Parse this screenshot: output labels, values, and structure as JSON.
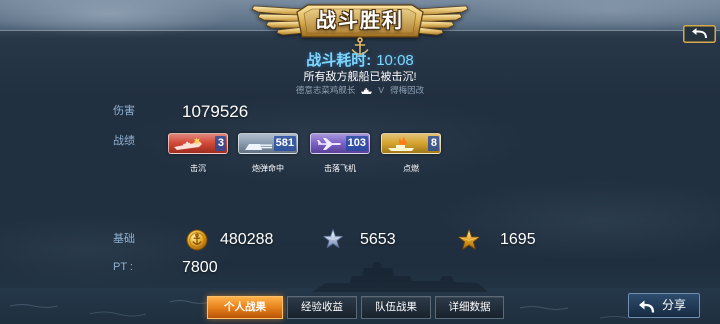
{
  "banner": {
    "title": "战斗胜利"
  },
  "battle": {
    "duration_label": "战斗耗时:",
    "duration_value": "10:08",
    "result_message": "所有敌方舰船已被击沉!",
    "captain_name": "德意志菜鸡舰长",
    "ship_type_icon": "battleship-icon",
    "ship_tier": "V",
    "ship_name": "得梅因改"
  },
  "damage": {
    "label": "伤害",
    "value": "1079526"
  },
  "record": {
    "label": "战绩",
    "badges": [
      {
        "label": "击沉",
        "count": "3",
        "icon": "sunk-ship-icon",
        "color": "#cf3c2b"
      },
      {
        "label": "炮弹命中",
        "count": "581",
        "icon": "shell-hit-icon",
        "color": "#8195ab"
      },
      {
        "label": "击落飞机",
        "count": "103",
        "icon": "plane-shot-down-icon",
        "color": "#7456c4"
      },
      {
        "label": "点燃",
        "count": "8",
        "icon": "fire-icon",
        "color": "#d29e22"
      }
    ]
  },
  "base": {
    "label": "基础",
    "rewards": [
      {
        "icon": "gold-coin-icon",
        "value": "480288"
      },
      {
        "icon": "silver-star-icon",
        "value": "5653"
      },
      {
        "icon": "gold-star-icon",
        "value": "1695"
      }
    ]
  },
  "pt": {
    "label": "PT :",
    "value": "7800"
  },
  "tabs": [
    {
      "label": "个人战果",
      "active": true
    },
    {
      "label": "经验收益",
      "active": false
    },
    {
      "label": "队伍战果",
      "active": false
    },
    {
      "label": "详细数据",
      "active": false
    }
  ],
  "share": {
    "label": "分享",
    "icon": "share-icon"
  },
  "back": {
    "icon": "return-arrow-icon"
  },
  "colors": {
    "accent_cyan": "#7fd6ff",
    "label_blue": "#8fb1d3",
    "active_tab": "#e8821c"
  }
}
